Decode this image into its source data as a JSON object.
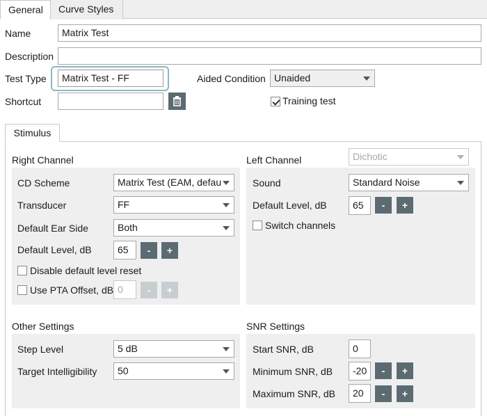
{
  "tabs": [
    {
      "label": "General",
      "active": true
    },
    {
      "label": "Curve Styles",
      "active": false
    }
  ],
  "general": {
    "name_label": "Name",
    "name_value": "Matrix Test",
    "description_label": "Description",
    "description_value": "",
    "test_type_label": "Test Type",
    "test_type_value": "Matrix Test - FF",
    "aided_label": "Aided Condition",
    "aided_value": "Unaided",
    "shortcut_label": "Shortcut",
    "shortcut_value": "",
    "delete_icon": "trash-icon",
    "training_label": "Training test",
    "training_checked": true
  },
  "stimulus": {
    "tab_label": "Stimulus",
    "right": {
      "title": "Right Channel",
      "cd_scheme_label": "CD Scheme",
      "cd_scheme_value": "Matrix Test (EAM, defau",
      "transducer_label": "Transducer",
      "transducer_value": "FF",
      "ear_side_label": "Default Ear Side",
      "ear_side_value": "Both",
      "level_label": "Default Level, dB",
      "level_value": "65",
      "minus": "-",
      "plus": "+",
      "disable_reset_label": "Disable default level reset",
      "pta_label": "Use PTA Offset, dB",
      "pta_value": "0"
    },
    "left": {
      "title": "Left Channel",
      "mode_value": "Dichotic",
      "sound_label": "Sound",
      "sound_value": "Standard Noise",
      "level_label": "Default Level, dB",
      "level_value": "65",
      "minus": "-",
      "plus": "+",
      "switch_label": "Switch channels"
    },
    "other": {
      "title": "Other Settings",
      "step_label": "Step Level",
      "step_value": "5 dB",
      "target_label": "Target Intelligibility",
      "target_value": "50"
    },
    "snr": {
      "title": "SNR Settings",
      "start_label": "Start SNR, dB",
      "start_value": "0",
      "min_label": "Minimum SNR, dB",
      "min_value": "-20",
      "max_label": "Maximum SNR, dB",
      "max_value": "20",
      "minus": "-",
      "plus": "+"
    }
  },
  "colors": {
    "button": "#5c6b72",
    "focus": "#8ab6c8",
    "panel": "#efefef"
  }
}
